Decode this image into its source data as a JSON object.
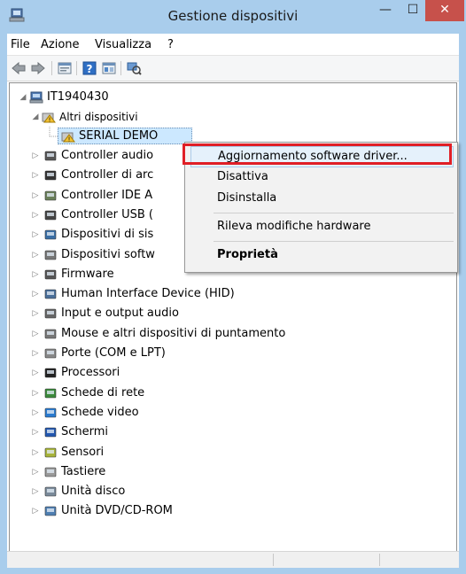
{
  "window": {
    "title": "Gestione dispositivi",
    "minimize": "—",
    "maximize": "☐",
    "close": "✕"
  },
  "menu": [
    "File",
    "Azione",
    "Visualizza",
    "?"
  ],
  "toolbar_icons": [
    "back-arrow-icon",
    "forward-arrow-icon",
    "properties-icon",
    "help-icon",
    "show-hidden-icon",
    "scan-hardware-icon"
  ],
  "tree": {
    "root": "IT1940430",
    "other_devices": "Altri dispositivi",
    "selected_device": "SERIAL DEMO",
    "categories": [
      "Controller audio",
      "Controller di arc",
      "Controller IDE A",
      "Controller USB (",
      "Dispositivi di sis",
      "Dispositivi softw",
      "Firmware",
      "Human Interface Device (HID)",
      "Input e output audio",
      "Mouse e altri dispositivi di puntamento",
      "Porte (COM e LPT)",
      "Processori",
      "Schede di rete",
      "Schede video",
      "Schermi",
      "Sensori",
      "Tastiere",
      "Unità disco",
      "Unità DVD/CD-ROM"
    ]
  },
  "context_menu": {
    "items": [
      "Aggiornamento software driver...",
      "Disattiva",
      "Disinstalla",
      "Rileva modifiche hardware",
      "Proprietà"
    ],
    "highlight_color": "#e01f26"
  }
}
